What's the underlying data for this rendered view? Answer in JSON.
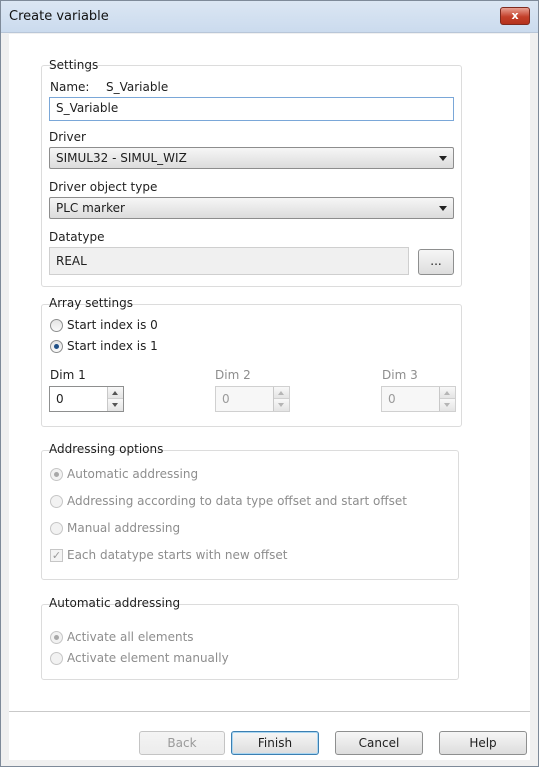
{
  "window": {
    "title": "Create variable",
    "close_label": "x"
  },
  "settings": {
    "group_label": "Settings",
    "name_label": "Name:",
    "name_value": "S_Variable",
    "name_input_value": "S_Variable",
    "driver_label": "Driver",
    "driver_value": "SIMUL32 - SIMUL_WIZ",
    "object_type_label": "Driver object type",
    "object_type_value": "PLC marker",
    "datatype_label": "Datatype",
    "datatype_value": "REAL",
    "browse_label": "..."
  },
  "array_settings": {
    "group_label": "Array settings",
    "start0_label": "Start index is 0",
    "start1_label": "Start index is 1",
    "start0_checked": false,
    "start1_checked": true,
    "dim1_label": "Dim 1",
    "dim2_label": "Dim 2",
    "dim3_label": "Dim 3",
    "dim1_value": "0",
    "dim2_value": "0",
    "dim3_value": "0"
  },
  "addressing_options": {
    "group_label": "Addressing options",
    "automatic_label": "Automatic addressing",
    "by_offset_label": "Addressing according to data type offset and start offset",
    "manual_label": "Manual addressing",
    "new_offset_label": "Each datatype starts with new offset",
    "automatic_checked": true,
    "new_offset_checked": true
  },
  "automatic_addressing": {
    "group_label": "Automatic addressing",
    "activate_all_label": "Activate all elements",
    "activate_manual_label": "Activate element manually",
    "activate_all_checked": true
  },
  "buttons": {
    "back": "Back",
    "finish": "Finish",
    "cancel": "Cancel",
    "help": "Help"
  },
  "colors": {
    "title_bar": "#cbdbee",
    "close_button": "#c4402a",
    "focus_border": "#7aa7d8",
    "default_button_border": "#3c7fb1"
  }
}
